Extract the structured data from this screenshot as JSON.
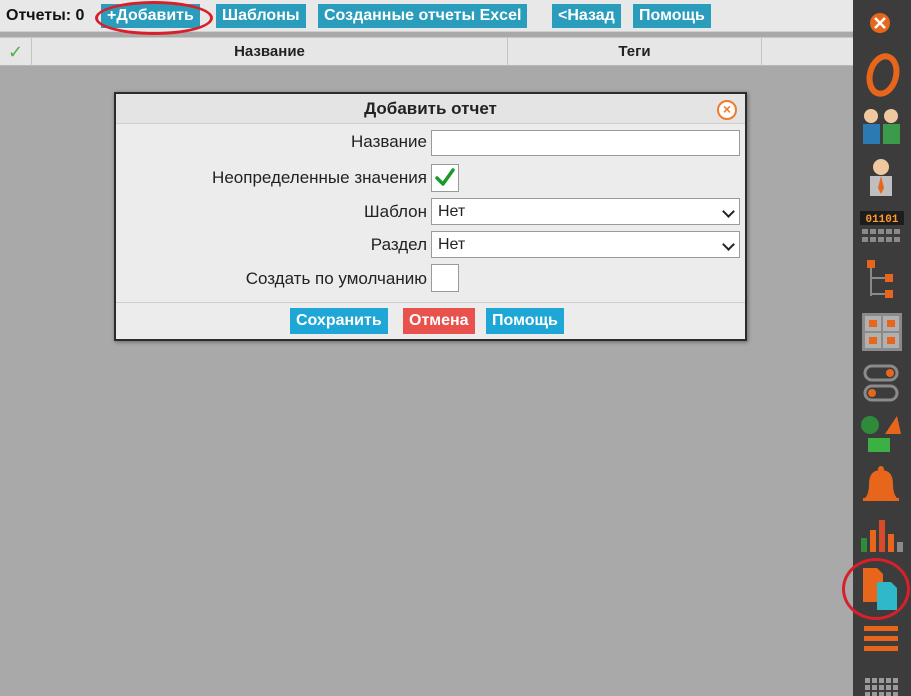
{
  "toolbar": {
    "reports_label": "Отчеты: 0",
    "add_label": "+Добавить",
    "templates_label": "Шаблоны",
    "excel_label": "Созданные отчеты Excel",
    "back_label": "<Назад",
    "help_label": "Помощь"
  },
  "table": {
    "check_header": "✓",
    "columns": [
      "Название",
      "Теги"
    ]
  },
  "dialog": {
    "title": "Добавить отчет",
    "fields": {
      "name_label": "Название",
      "name_value": "",
      "undefined_label": "Неопределенные значения",
      "undefined_checked": true,
      "template_label": "Шаблон",
      "template_value": "Нет",
      "section_label": "Раздел",
      "section_value": "Нет",
      "default_label": "Создать по умолчанию",
      "default_checked": false
    },
    "buttons": {
      "save": "Сохранить",
      "cancel": "Отмена",
      "help": "Помощь"
    }
  },
  "sidebar": {
    "icons": [
      "close-icon",
      "o-logo-icon",
      "users-group-icon",
      "user-icon",
      "binary-counter-icon",
      "tree-structure-icon",
      "grid-blocks-icon",
      "toggle-switch-icon",
      "shapes-icon",
      "bell-icon",
      "bar-chart-icon",
      "reports-document-icon",
      "menu-lines-icon",
      "calendar-grid-icon"
    ],
    "binary_text": "01101"
  },
  "colors": {
    "accent_blue": "#2a9cbc",
    "button_blue": "#1ea6d6",
    "cancel_red": "#e9514d",
    "icon_orange": "#e8661c",
    "annotation_red": "#d9202a",
    "sidebar_bg": "#3c3c3c"
  }
}
